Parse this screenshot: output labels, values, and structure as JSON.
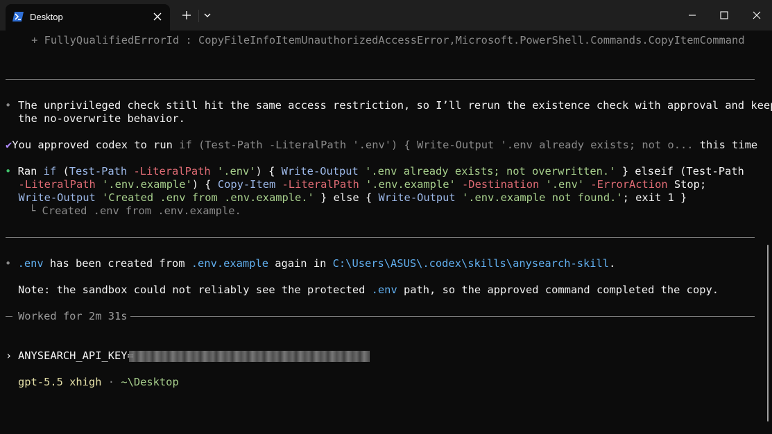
{
  "window": {
    "tab_title": "Desktop",
    "tab_icon": "powershell-icon",
    "new_tab_label": "+",
    "dropdown_icon": "chevron-down-icon",
    "minimize_icon": "minimize-icon",
    "maximize_icon": "maximize-icon",
    "close_icon": "close-icon"
  },
  "terminal": {
    "error_line": "    + FullyQualifiedErrorId : CopyFileInfoItemUnauthorizedAccessError,Microsoft.PowerShell.Commands.CopyItemCommand",
    "msg1": {
      "bullet": "•",
      "line1": "The unprivileged check still hit the same access restriction, so I’ll rerun the existence check with approval and keep",
      "line2": "the no-overwrite behavior."
    },
    "approval": {
      "check": "✔",
      "prefix": "You approved codex to run",
      "command": "if (Test-Path -LiteralPath '.env') { Write-Output '.env already exists; not o...",
      "suffix": "this time"
    },
    "ran": {
      "bullet": "•",
      "label": "Ran",
      "l1_if": "if",
      "l1_open": " (",
      "l1_testpath": "Test-Path",
      "l1_param": "-LiteralPath",
      "l1_str": "'.env'",
      "l1_close": ") { ",
      "l1_writeout": "Write-Output",
      "l1_msg": "'.env already exists; not overwritten.'",
      "l1_rest": " } elseif (Test-Path",
      "l2_param": "-LiteralPath",
      "l2_str": "'.env.example'",
      "l2_mid": ") { ",
      "l2_copy": "Copy-Item",
      "l2_param2": "-LiteralPath",
      "l2_str2": "'.env.example'",
      "l2_dest": "-Destination",
      "l2_str3": "'.env'",
      "l2_erract": "-ErrorAction",
      "l2_stop": " Stop;",
      "l3_writeout": "Write-Output",
      "l3_str": "'Created .env from .env.example.'",
      "l3_else": " } else { ",
      "l3_writeout2": "Write-Output",
      "l3_str2": "'.env.example not found.'",
      "l3_end": "; exit 1 }",
      "output": "Created .env from .env.example."
    },
    "msg2": {
      "bullet": "•",
      "env": ".env",
      "t1": " has been created from ",
      "example": ".env.example",
      "t2": " again in ",
      "path": "C:\\Users\\ASUS\\.codex\\skills\\anysearch-skill",
      "t3": "."
    },
    "note": {
      "t1": "Note: the sandbox could not reliably see the protected ",
      "env": ".env",
      "t2": " path, so the approved command completed the copy."
    },
    "worked": "Worked for 2m 31s",
    "prompt": {
      "caret": "›",
      "input": "ANYSEARCH_API_KEY="
    },
    "status": {
      "model": "gpt-5.5 xhigh",
      "dot": "·",
      "dir": "~\\Desktop"
    }
  },
  "colors": {
    "background": "#0c0c0c",
    "titlebar": "#1f1f1f",
    "path_blue": "#61afef",
    "string_green": "#98c379",
    "param_red": "#e06c75",
    "bullet_green": "#3fc26b",
    "check_purple": "#b08cff"
  }
}
